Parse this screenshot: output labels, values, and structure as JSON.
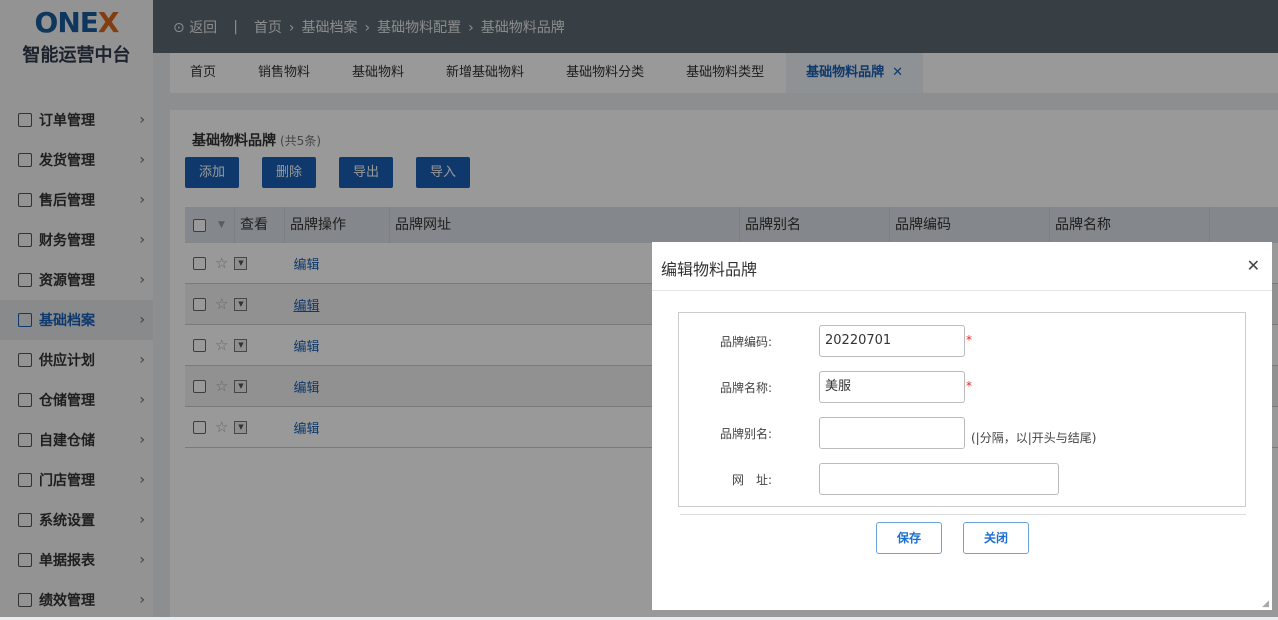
{
  "logo": {
    "brand": "ONE",
    "brand_x": "X",
    "subtitle": "智能运营中台"
  },
  "sidebar": {
    "items": [
      {
        "label": "订单管理"
      },
      {
        "label": "发货管理"
      },
      {
        "label": "售后管理"
      },
      {
        "label": "财务管理"
      },
      {
        "label": "资源管理"
      },
      {
        "label": "基础档案"
      },
      {
        "label": "供应计划"
      },
      {
        "label": "仓储管理"
      },
      {
        "label": "自建仓储"
      },
      {
        "label": "门店管理"
      },
      {
        "label": "系统设置"
      },
      {
        "label": "单据报表"
      },
      {
        "label": "绩效管理"
      }
    ],
    "active_index": 5
  },
  "topbar": {
    "back": "返回",
    "breadcrumb": [
      "首页",
      "基础档案",
      "基础物料配置",
      "基础物料品牌"
    ]
  },
  "tabs": [
    {
      "label": "首页"
    },
    {
      "label": "销售物料"
    },
    {
      "label": "基础物料"
    },
    {
      "label": "新增基础物料"
    },
    {
      "label": "基础物料分类"
    },
    {
      "label": "基础物料类型"
    },
    {
      "label": "基础物料品牌"
    }
  ],
  "page": {
    "title": "基础物料品牌",
    "count": "(共5条)",
    "buttons": [
      "添加",
      "删除",
      "导出",
      "导入"
    ]
  },
  "table": {
    "columns": [
      "查看",
      "品牌操作",
      "品牌网址",
      "品牌别名",
      "品牌编码",
      "品牌名称"
    ],
    "rows": [
      {
        "action": "编辑"
      },
      {
        "action": "编辑"
      },
      {
        "action": "编辑"
      },
      {
        "action": "编辑"
      },
      {
        "action": "编辑"
      }
    ]
  },
  "modal": {
    "title": "编辑物料品牌",
    "fields": [
      {
        "label": "品牌编码:",
        "value": "20220701",
        "required": "*"
      },
      {
        "label": "品牌名称:",
        "value": "美服",
        "required": "*"
      },
      {
        "label": "品牌别名:",
        "value": "",
        "hint": "(|分隔，以|开头与结尾)"
      },
      {
        "label": "网　址:",
        "value": ""
      }
    ],
    "save": "保存",
    "close": "关闭"
  }
}
